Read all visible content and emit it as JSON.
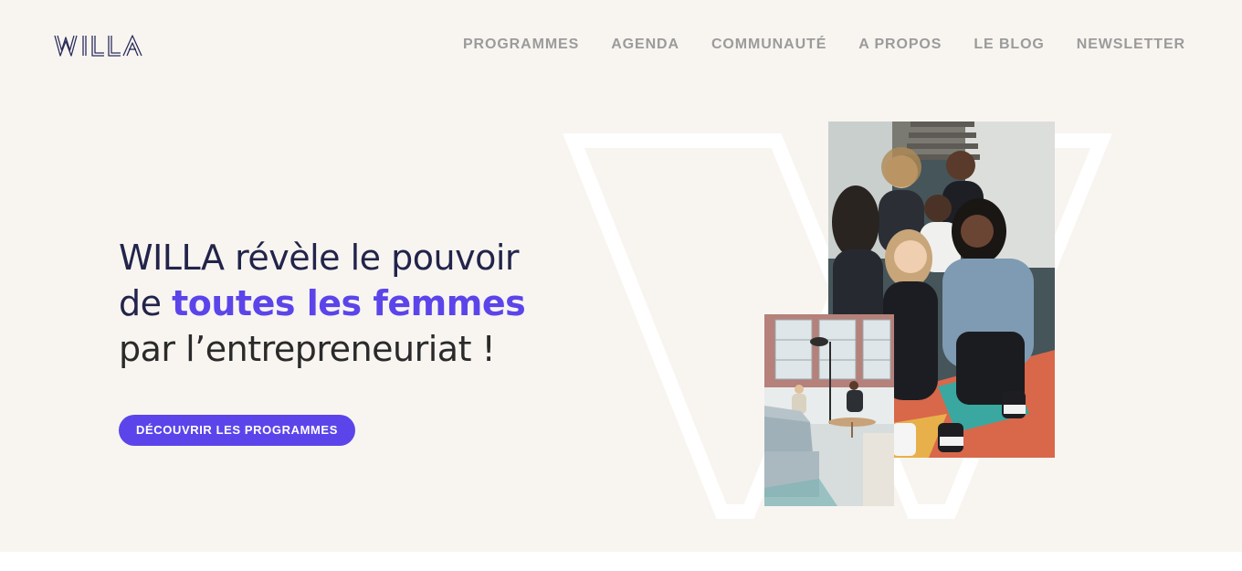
{
  "brand": {
    "logo_text": "WILLA"
  },
  "nav": {
    "items": [
      {
        "label": "PROGRAMMES"
      },
      {
        "label": "AGENDA"
      },
      {
        "label": "COMMUNAUTÉ"
      },
      {
        "label": "A PROPOS"
      },
      {
        "label": "LE BLOG"
      },
      {
        "label": "NEWSLETTER"
      }
    ]
  },
  "hero": {
    "headline_line1": "WILLA révèle le pouvoir",
    "headline_line2_prefix": "de ",
    "headline_line2_accent": "toutes les femmes",
    "headline_line3": "par l’entrepreneuriat !",
    "cta_label": "DÉCOUVRIR LES PROGRAMMES"
  },
  "images": {
    "main_photo": "group-of-women-on-stairs-photo",
    "small_photo": "coworking-lounge-photo"
  },
  "colors": {
    "accent": "#5b45ea",
    "navy": "#22244a",
    "nav_text": "#9b9b9b",
    "hero_bg": "#f8f5f1"
  }
}
